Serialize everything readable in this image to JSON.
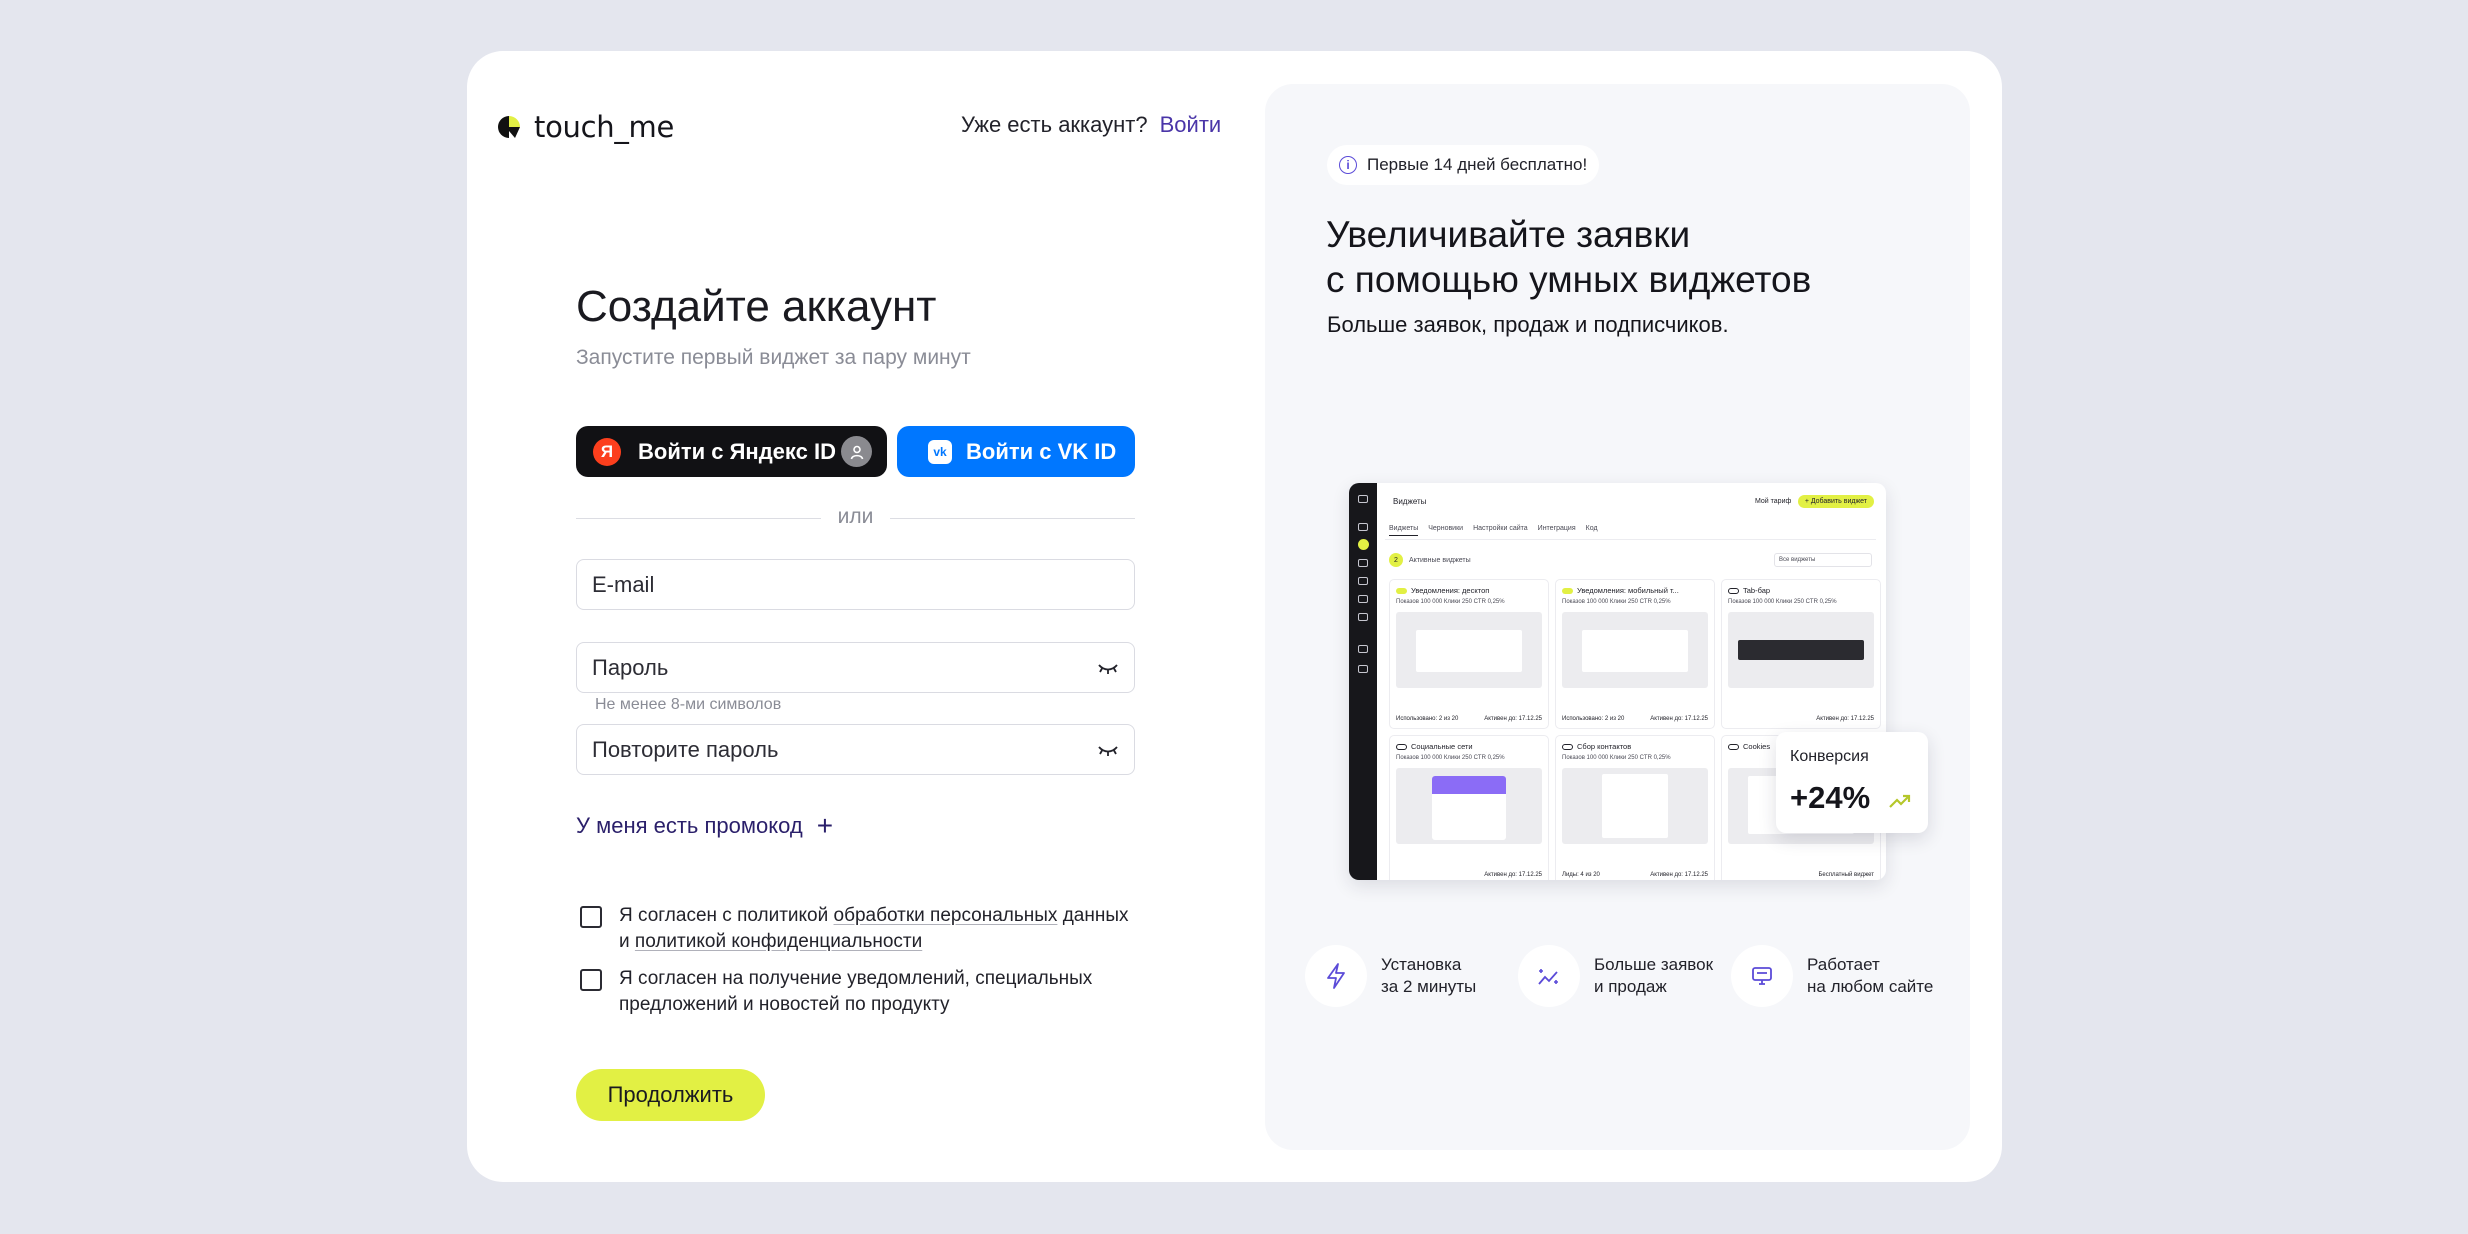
{
  "brand": {
    "name": "touch_me"
  },
  "header": {
    "question": "Уже есть аккаунт?",
    "login_link": "Войти"
  },
  "form": {
    "title": "Создайте аккаунт",
    "subtitle": "Запустите первый виджет за пару минут",
    "yandex_button": "Войти с Яндекс ID",
    "yandex_letter": "Я",
    "vk_button": "Войти с VK ID",
    "vk_letter": "vk",
    "divider": "или",
    "email_placeholder": "E-mail",
    "password_placeholder": "Пароль",
    "password_hint": "Не менее 8-ми символов",
    "repeat_placeholder": "Повторите пароль",
    "promo": "У меня есть промокод",
    "promo_plus": "+",
    "consent1": {
      "prefix": "Я согласен с политикой ",
      "link1": "обработки персональных",
      "mid": " данных",
      "line2_prefix": "и ",
      "link2": "политикой конфиденциальности"
    },
    "consent2": "Я согласен на получение уведомлений, специальных предложений и новостей по продукту",
    "continue": "Продолжить"
  },
  "promo_panel": {
    "badge": "Первые 14 дней бесплатно!",
    "headline": "Увеличивайте заявки\nс помощью умных виджетов",
    "subhead": "Больше заявок, продаж и подписчиков.",
    "mock": {
      "title": "Виджеты",
      "tariff": "Мой тариф",
      "add": "+ Добавить виджет",
      "tabs": [
        "Виджеты",
        "Черновики",
        "Настройки сайта",
        "Интеграция",
        "Код"
      ],
      "active_count": "2",
      "active_label": "Активные виджеты",
      "filter": "Все виджеты",
      "cards": [
        {
          "title": "Уведомления: десктоп",
          "stats": "Показов 100 000   Клики 250   CTR 0,25%",
          "footer_l": "Использовано: 2 из 20",
          "footer_r": "Активен до: 17.12.25"
        },
        {
          "title": "Уведомления: мобильный т...",
          "stats": "Показов 100 000   Клики 250   CTR 0,25%",
          "footer_l": "Использовано: 2 из 20",
          "footer_r": "Активен до: 17.12.25"
        },
        {
          "title": "Tab-бар",
          "stats": "Показов 100 000   Клики 250   CTR 0,25%",
          "footer_l": "",
          "footer_r": "Активен до: 17.12.25"
        },
        {
          "title": "Социальные сети",
          "stats": "Показов 100 000   Клики 250   CTR 0,25%",
          "footer_l": "",
          "footer_r": "Активен до: 17.12.25"
        },
        {
          "title": "Сбор контактов",
          "stats": "Показов 100 000   Клики 250   CTR 0,25%",
          "footer_l": "Лиды: 4 из 20",
          "footer_r": "Активен до: 17.12.25"
        },
        {
          "title": "Cookies",
          "stats": "",
          "footer_l": "",
          "footer_r": "Бесплатный виджет"
        }
      ]
    },
    "conversion": {
      "label": "Конверсия",
      "value": "+24%"
    },
    "features": [
      {
        "icon": "lightning-icon",
        "text": "Установка\nза 2 минуты"
      },
      {
        "icon": "sparkle-chart-icon",
        "text": "Больше заявок\nи продаж"
      },
      {
        "icon": "monitor-icon",
        "text": "Работает\nна любом сайте"
      }
    ]
  },
  "colors": {
    "accent": "#e2f044",
    "vk": "#0077ff",
    "yandex": "#fc3f1d",
    "link": "#4a35a8",
    "panel": "#f6f7fa"
  }
}
